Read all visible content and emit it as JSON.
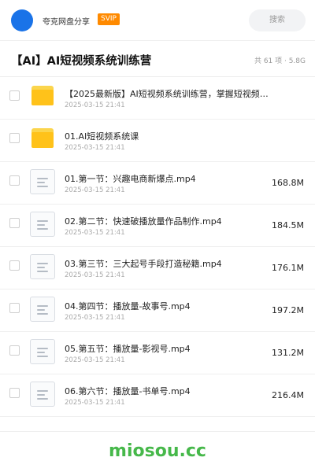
{
  "header": {
    "username": "夸克网盘分享",
    "badge": "SVIP",
    "search_placeholder": "搜索"
  },
  "share": {
    "title": "【AI】AI短视频系统训练营",
    "meta": "共 61 项 · 5.8G"
  },
  "files": [
    {
      "type": "folder",
      "name": "【2025最新版】AI短视频系统训练营，掌握短视频…",
      "date": "2025-03-15 21:41",
      "size": ""
    },
    {
      "type": "folder",
      "name": "01.AI短视频系统课",
      "date": "2025-03-15 21:41",
      "size": ""
    },
    {
      "type": "video",
      "name": "01.第一节：兴趣电商新爆点.mp4",
      "date": "2025-03-15 21:41",
      "size": "168.8M"
    },
    {
      "type": "video",
      "name": "02.第二节：快速破播放量作品制作.mp4",
      "date": "2025-03-15 21:41",
      "size": "184.5M"
    },
    {
      "type": "video",
      "name": "03.第三节：三大起号手段打造秘籍.mp4",
      "date": "2025-03-15 21:41",
      "size": "176.1M"
    },
    {
      "type": "video",
      "name": "04.第四节：播放量-故事号.mp4",
      "date": "2025-03-15 21:41",
      "size": "197.2M"
    },
    {
      "type": "video",
      "name": "05.第五节：播放量-影视号.mp4",
      "date": "2025-03-15 21:41",
      "size": "131.2M"
    },
    {
      "type": "video",
      "name": "06.第六节：播放量-书单号.mp4",
      "date": "2025-03-15 21:41",
      "size": "216.4M"
    }
  ],
  "watermark": "miosou.cc"
}
